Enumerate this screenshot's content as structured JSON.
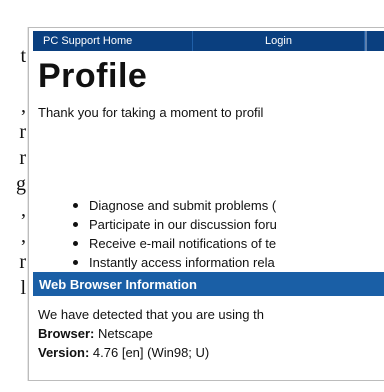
{
  "nav": {
    "home": "PC Support Home",
    "login": "Login"
  },
  "page": {
    "title": "Profile",
    "intro": "Thank you for taking a moment to profil"
  },
  "bullets": [
    "Diagnose and submit problems (",
    "Participate in our discussion foru",
    "Receive e-mail notifications of te",
    "Instantly access information rela"
  ],
  "browser_section": {
    "title": "Web Browser Information",
    "detected_text": "We have detected that you are using th",
    "browser_label": "Browser:",
    "browser_value": "Netscape",
    "version_label": "Version:",
    "version_value": "4.76 [en] (Win98; U)"
  },
  "colors": {
    "nav_bg": "#0a3f7f",
    "section_bg": "#1a5fa6"
  }
}
